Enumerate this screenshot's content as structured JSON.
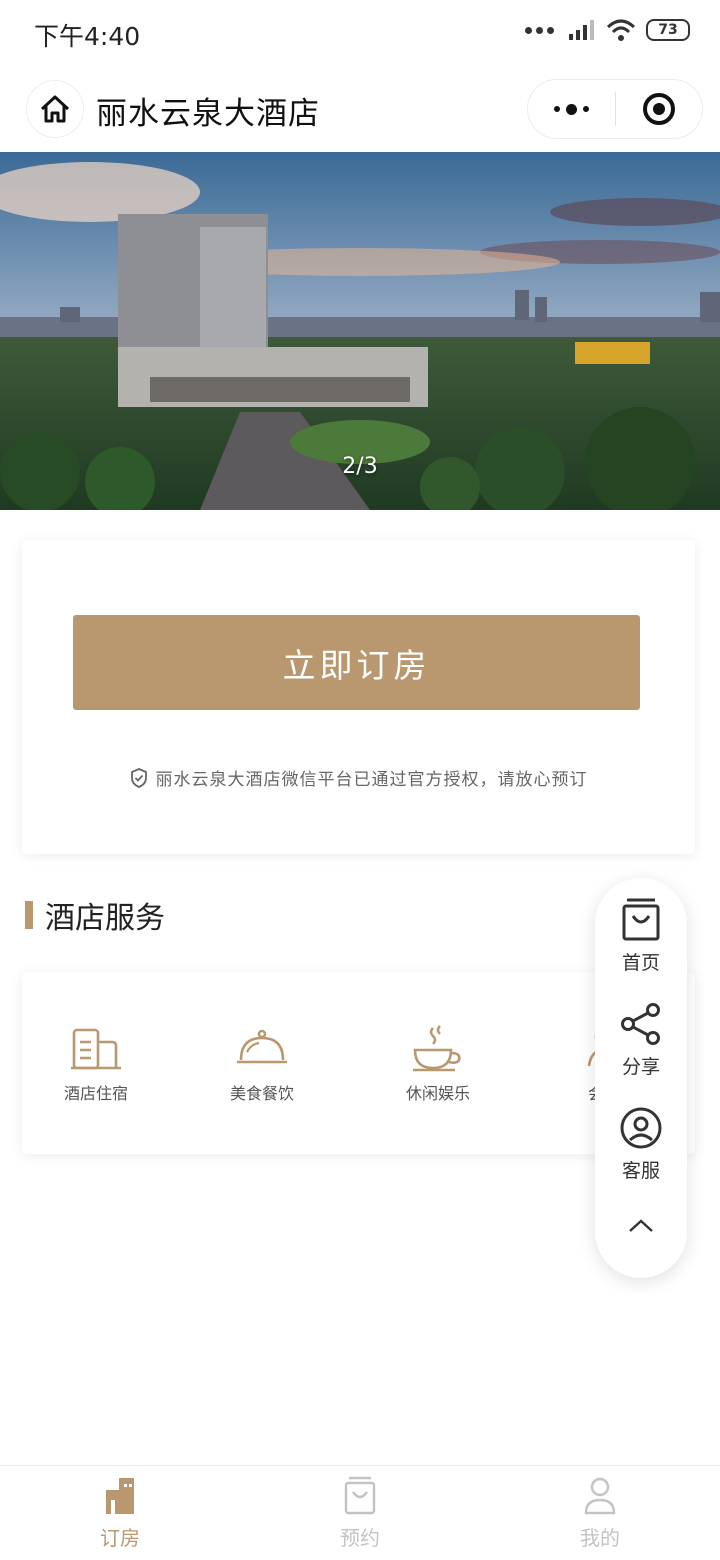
{
  "status_bar": {
    "time": "下午4:40",
    "battery": "73"
  },
  "nav": {
    "title": "丽水云泉大酒店"
  },
  "banner": {
    "pager": "2/3"
  },
  "booking": {
    "button_label": "立即订房",
    "auth_notice": "丽水云泉大酒店微信平台已通过官方授权，请放心预订"
  },
  "services": {
    "title": "酒店服务",
    "items": [
      {
        "label": "酒店住宿",
        "icon": "hotel-building-icon"
      },
      {
        "label": "美食餐饮",
        "icon": "dining-cloche-icon"
      },
      {
        "label": "休闲娱乐",
        "icon": "coffee-cup-icon"
      },
      {
        "label": "会议",
        "icon": "meeting-person-icon"
      }
    ]
  },
  "float_panel": {
    "items": [
      {
        "label": "首页",
        "icon": "bag-home-icon"
      },
      {
        "label": "分享",
        "icon": "share-icon"
      },
      {
        "label": "客服",
        "icon": "customer-service-icon"
      }
    ]
  },
  "tab_bar": {
    "tabs": [
      {
        "label": "订房",
        "icon": "building-icon",
        "active": true
      },
      {
        "label": "预约",
        "icon": "bag-icon",
        "active": false
      },
      {
        "label": "我的",
        "icon": "user-icon",
        "active": false
      }
    ]
  },
  "colors": {
    "accent": "#b99870",
    "inactive": "#c3c3c3"
  }
}
